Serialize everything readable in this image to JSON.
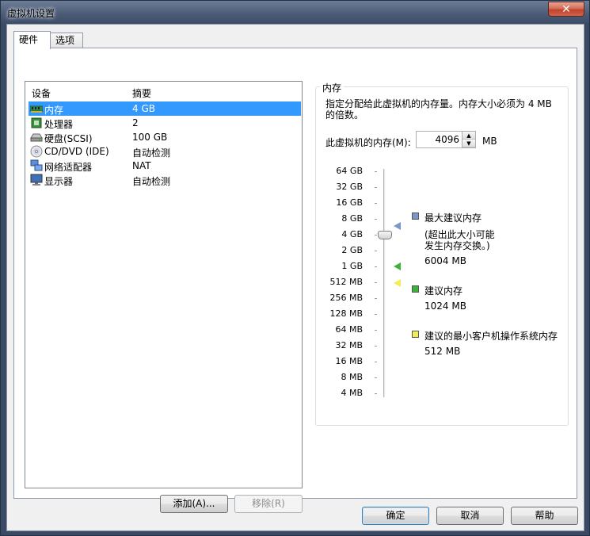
{
  "window": {
    "title": "虚拟机设置",
    "close_glyph": "✕"
  },
  "tabs": [
    {
      "label": "硬件",
      "active": true
    },
    {
      "label": "选项",
      "active": false
    }
  ],
  "device_list": {
    "headers": {
      "device": "设备",
      "summary": "摘要"
    },
    "rows": [
      {
        "name": "内存",
        "value": "4 GB",
        "icon": "memory-icon",
        "selected": true
      },
      {
        "name": "处理器",
        "value": "2",
        "icon": "processor-icon",
        "selected": false
      },
      {
        "name": "硬盘(SCSI)",
        "value": "100 GB",
        "icon": "harddisk-icon",
        "selected": false
      },
      {
        "name": "CD/DVD (IDE)",
        "value": "自动检测",
        "icon": "cd-dvd-icon",
        "selected": false
      },
      {
        "name": "网络适配器",
        "value": "NAT",
        "icon": "network-adapter-icon",
        "selected": false
      },
      {
        "name": "显示器",
        "value": "自动检测",
        "icon": "monitor-icon",
        "selected": false
      }
    ],
    "add_button": "添加(A)...",
    "remove_button": "移除(R)"
  },
  "memory": {
    "group_title": "内存",
    "description": "指定分配给此虚拟机的内存量。内存大小必须为 4 MB 的倍数。",
    "field_label": "此虚拟机的内存(M):",
    "field_value": "4096",
    "unit": "MB",
    "scale": [
      "64 GB",
      "32 GB",
      "16 GB",
      "8 GB",
      "4 GB",
      "2 GB",
      "1 GB",
      "512 MB",
      "256 MB",
      "128 MB",
      "64 MB",
      "32 MB",
      "16 MB",
      "8 MB",
      "4 MB"
    ],
    "legend": {
      "max": {
        "title": "最大建议内存",
        "note_line1": "(超出此大小可能",
        "note_line2": "发生内存交换。)",
        "value": "6004 MB",
        "color": "#7b96c9"
      },
      "recommended": {
        "title": "建议内存",
        "value": "1024 MB",
        "color": "#3cb43c"
      },
      "min": {
        "title": "建议的最小客户机操作系统内存",
        "value": "512 MB",
        "color": "#f2ee58"
      }
    }
  },
  "footer": {
    "ok": "确定",
    "cancel": "取消",
    "help": "帮助"
  }
}
